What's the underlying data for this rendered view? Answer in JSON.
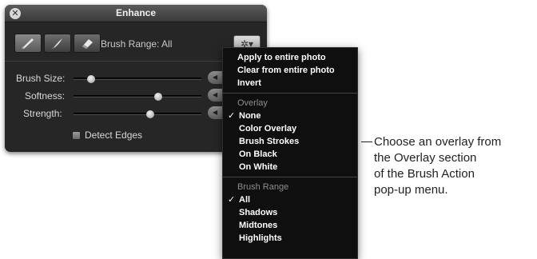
{
  "window": {
    "title": "Enhance"
  },
  "toolbar": {
    "brush_range_label": "Brush Range: All",
    "tools": [
      {
        "name": "brush-tool-icon"
      },
      {
        "name": "feather-brush-tool-icon"
      },
      {
        "name": "eraser-tool-icon"
      }
    ],
    "action_icon": "gear-icon",
    "action_glyph": "✲▾"
  },
  "sliders": [
    {
      "label": "Brush Size:",
      "value": 0.14
    },
    {
      "label": "Softness:",
      "value": 0.66
    },
    {
      "label": "Strength:",
      "value": 0.6
    }
  ],
  "stepper_glyph": "◀",
  "detect_edges": {
    "label": "Detect Edges",
    "checked": false
  },
  "menu": {
    "actions": [
      "Apply to entire photo",
      "Clear from entire photo",
      "Invert"
    ],
    "overlay_header": "Overlay",
    "overlay_items": [
      {
        "label": "None",
        "checked": true
      },
      {
        "label": "Color Overlay",
        "checked": false
      },
      {
        "label": "Brush Strokes",
        "checked": false
      },
      {
        "label": "On Black",
        "checked": false
      },
      {
        "label": "On White",
        "checked": false
      }
    ],
    "range_header": "Brush Range",
    "range_items": [
      {
        "label": "All",
        "checked": true
      },
      {
        "label": "Shadows",
        "checked": false
      },
      {
        "label": "Midtones",
        "checked": false
      },
      {
        "label": "Highlights",
        "checked": false
      }
    ]
  },
  "callout": {
    "lines": [
      "Choose an overlay from",
      "the Overlay section",
      "of the Brush Action",
      "pop-up menu."
    ]
  }
}
